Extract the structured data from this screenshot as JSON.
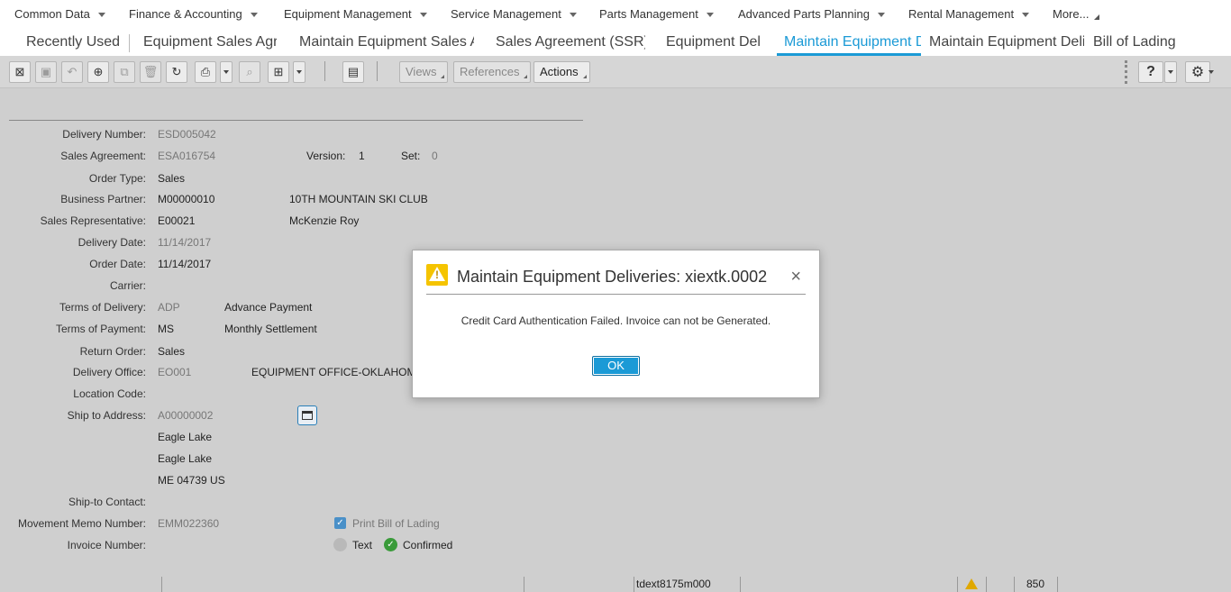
{
  "menu": [
    {
      "label": "Common Data"
    },
    {
      "label": "Finance & Accounting"
    },
    {
      "label": "Equipment Management"
    },
    {
      "label": "Service Management"
    },
    {
      "label": "Parts Management"
    },
    {
      "label": "Advanced Parts Planning"
    },
    {
      "label": "Rental Management"
    },
    {
      "label": "More..."
    }
  ],
  "tabs": [
    {
      "label": "Recently Used"
    },
    {
      "label": "Equipment Sales Agreements"
    },
    {
      "label": "Maintain Equipment Sales Agreements"
    },
    {
      "label": "Sales Agreement (SSR)"
    },
    {
      "label": "Equipment Deliveries"
    },
    {
      "label": "Maintain Equipment Deliveries"
    },
    {
      "label": "Maintain Equipment Deliveries"
    },
    {
      "label": "Bill of Lading"
    }
  ],
  "toolbar": {
    "views": "Views",
    "references": "References",
    "actions": "Actions",
    "help": "?"
  },
  "form": {
    "delivery_number": {
      "label": "Delivery Number:",
      "value": "ESD005042"
    },
    "sales_agreement": {
      "label": "Sales Agreement:",
      "value": "ESA016754"
    },
    "version": {
      "label": "Version:",
      "value": "1"
    },
    "set": {
      "label": "Set:",
      "value": "0"
    },
    "order_type": {
      "label": "Order Type:",
      "value": "Sales"
    },
    "business_partner": {
      "label": "Business Partner:",
      "value": "M00000010",
      "name": "10TH MOUNTAIN SKI CLUB"
    },
    "sales_rep": {
      "label": "Sales Representative:",
      "value": "E00021",
      "name": "McKenzie Roy"
    },
    "delivery_date": {
      "label": "Delivery Date:",
      "value": "11/14/2017"
    },
    "order_date": {
      "label": "Order Date:",
      "value": "11/14/2017"
    },
    "carrier": {
      "label": "Carrier:"
    },
    "terms_delivery": {
      "label": "Terms of Delivery:",
      "value": "ADP",
      "desc": "Advance Payment"
    },
    "terms_payment": {
      "label": "Terms of Payment:",
      "value": "MS",
      "desc": "Monthly Settlement"
    },
    "return_order": {
      "label": "Return Order:",
      "value": "Sales"
    },
    "delivery_office": {
      "label": "Delivery Office:",
      "value": "EO001",
      "desc": "EQUIPMENT OFFICE-OKLAHOM"
    },
    "location_code": {
      "label": "Location Code:"
    },
    "ship_to_address": {
      "label": "Ship to Address:",
      "value": "A00000002",
      "line1": "Eagle Lake",
      "line2": "Eagle Lake",
      "line3": "ME 04739 US"
    },
    "ship_to_contact": {
      "label": "Ship-to Contact:"
    },
    "movement_memo": {
      "label": "Movement Memo Number:",
      "value": "EMM022360"
    },
    "print_bol": "Print Bill of Lading",
    "invoice_number": {
      "label": "Invoice Number:"
    },
    "status_text": "Text",
    "status_confirmed": "Confirmed"
  },
  "statusbar": {
    "session": "tdext8175m000",
    "count": "850"
  },
  "dialog": {
    "title": "Maintain Equipment Deliveries: xiextk.0002",
    "message": "Credit Card Authentication Failed. Invoice can not be Generated.",
    "ok": "OK",
    "close": "×"
  },
  "colors": {
    "accent": "#1b9ad6",
    "warning": "#f5c400",
    "confirmed": "#3a9b3a",
    "background": "#cfcfcf"
  }
}
